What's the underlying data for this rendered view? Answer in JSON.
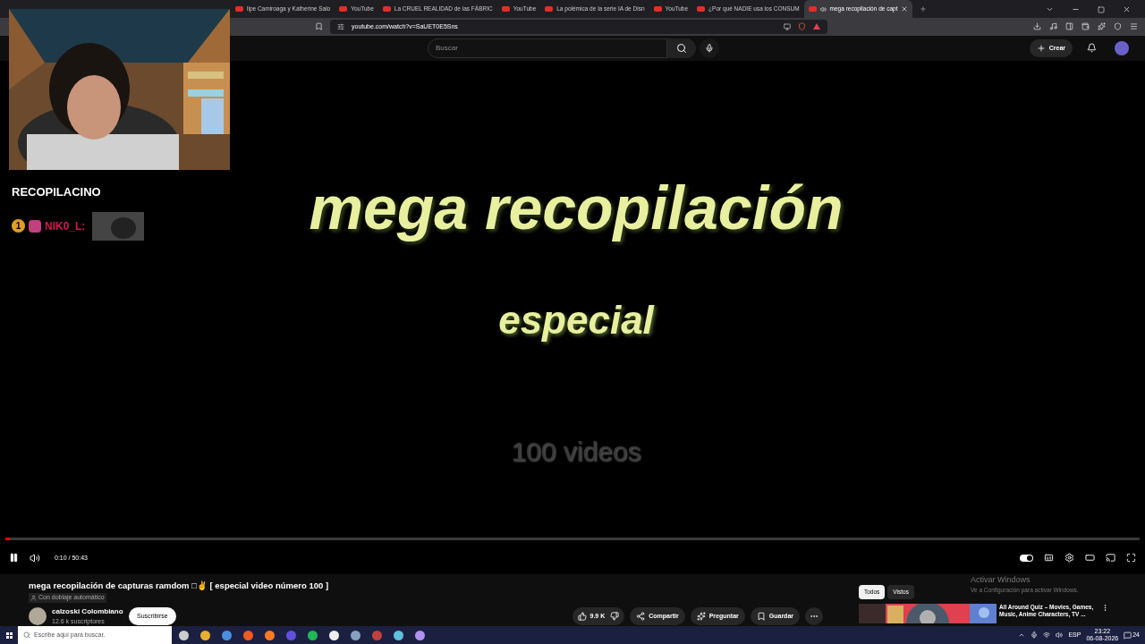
{
  "browser": {
    "tabs": [
      {
        "title": "lipe Camiroaga y Katherine Salo",
        "selected": false
      },
      {
        "title": "YouTube",
        "selected": false
      },
      {
        "title": "La CRUEL REALIDAD de las FÁBRIC",
        "selected": false
      },
      {
        "title": "YouTube",
        "selected": false
      },
      {
        "title": "La polémica de la serie IA de Disn",
        "selected": false
      },
      {
        "title": "YouTube",
        "selected": false
      },
      {
        "title": "¿Por qué NADIE usa los CONSUM",
        "selected": false
      },
      {
        "title": "mega recopilación de capt",
        "selected": true
      }
    ],
    "url": "youtube.com/watch?v=SaUET0E5Sns"
  },
  "header": {
    "search_placeholder": "Buscar",
    "create": "Crear"
  },
  "overlay": {
    "chat": [
      {
        "kind": "text",
        "text": "RECOPILACINO"
      },
      {
        "kind": "message",
        "badge": "1",
        "user": "NIK0_L:"
      }
    ]
  },
  "video": {
    "lines": [
      {
        "kind": "title",
        "text": "mega recopilación"
      },
      {
        "kind": "subtitle",
        "text": "especial"
      },
      {
        "kind": "faint",
        "text": "100 videos"
      }
    ],
    "progress": {
      "level": 0.004
    },
    "playing": true,
    "time": "0:10 / 50:43",
    "autoplay": true
  },
  "info": {
    "title": "mega recopilación de capturas ramdom □✌ [ especial video número 100 ]",
    "dubbing": "Con doblaje automático",
    "channel": "calzoski Colombiano",
    "subscribers": "12.6 k suscriptores",
    "subscribe": "Suscribirse",
    "likes": "9.9 K",
    "actions": [
      "Compartir",
      "Preguntar",
      "Guardar"
    ]
  },
  "chips": [
    {
      "label": "Todos",
      "selected": true
    },
    {
      "label": "Vistos",
      "selected": false
    }
  ],
  "recommendation": {
    "title": "All Around Quiz – Movies, Games, Music, Anime Characters, TV ..."
  },
  "activation": {
    "title": "Activar Windows",
    "text": "Ve a Configuración para activar Windows."
  },
  "taskbar": {
    "search_placeholder": "Escribe aquí para buscar.",
    "language": "ESP",
    "time": "23:22",
    "date": "06-08-2026",
    "notifications": "24"
  }
}
